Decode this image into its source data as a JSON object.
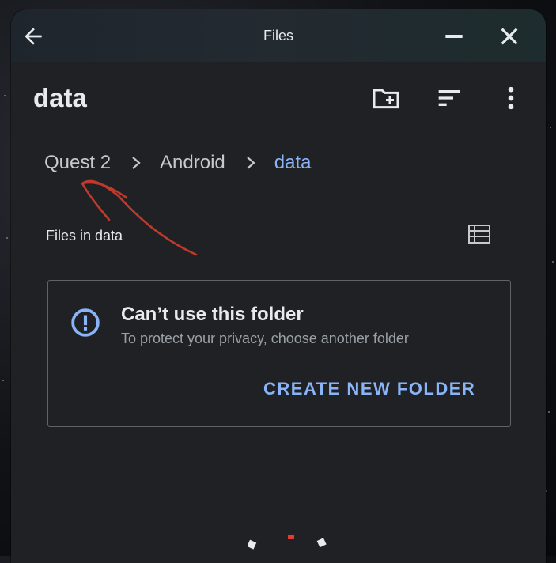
{
  "titlebar": {
    "title": "Files"
  },
  "appbar": {
    "title": "data"
  },
  "breadcrumb": [
    "Quest 2",
    "Android",
    "data"
  ],
  "section": {
    "label": "Files in data"
  },
  "notice": {
    "title": "Can’t use this folder",
    "subtitle": "To protect your privacy, choose another folder",
    "action": "CREATE NEW FOLDER"
  },
  "icons": {
    "back": "arrow-back-icon",
    "minimize": "minimize-icon",
    "close": "close-icon",
    "new_folder": "create-new-folder-icon",
    "sort": "sort-icon",
    "more": "more-vert-icon",
    "list_view": "list-view-icon",
    "info": "info-icon"
  },
  "colors": {
    "accent": "#8ab4f8",
    "annotation": "#c0392b"
  }
}
